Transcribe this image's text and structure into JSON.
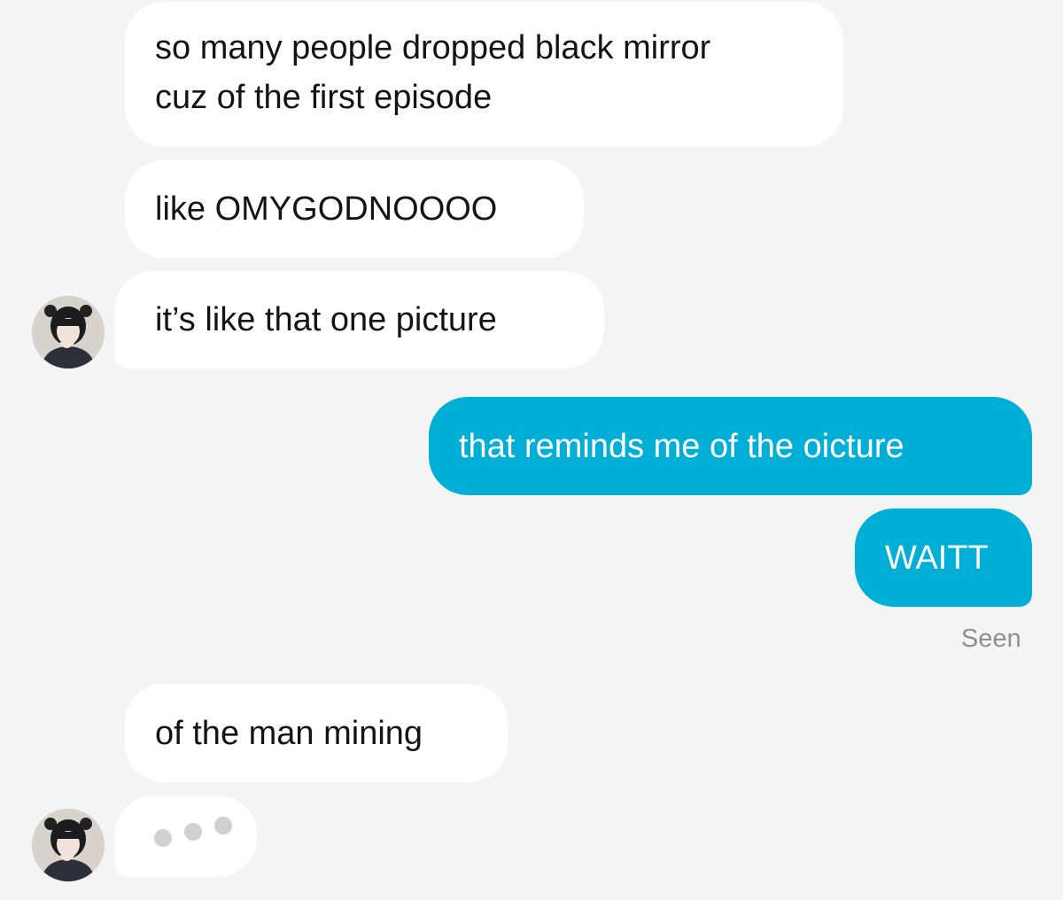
{
  "conversation": {
    "messages": [
      {
        "sender": "them",
        "lines": [
          "so many people dropped black mirror",
          "cuz of the first episode"
        ]
      },
      {
        "sender": "them",
        "text": "like OMYGODNOOOO"
      },
      {
        "sender": "them",
        "text": "it’s like that one picture"
      },
      {
        "sender": "me",
        "text": "that reminds me of the oicture"
      },
      {
        "sender": "me",
        "text": "WAITT"
      },
      {
        "sender": "them",
        "text": "of the man mining"
      }
    ],
    "seen_label": "Seen",
    "typing_indicator": true
  },
  "colors": {
    "background": "#f4f4f4",
    "incoming_bubble": "#ffffff",
    "outgoing_bubble": "#00aed6",
    "outgoing_text": "#ffffff",
    "incoming_text": "#141414",
    "seen_text": "#8e8e8e"
  },
  "icons": [
    "avatar",
    "typing-indicator-icon"
  ]
}
